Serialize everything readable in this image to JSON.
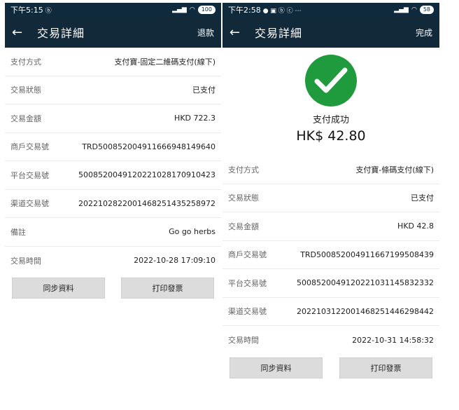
{
  "left": {
    "status_time": "下午5:15",
    "battery": "100",
    "title": "交易詳細",
    "action": "退款",
    "rows": [
      {
        "label": "支付方式",
        "value": "支付寶-固定二維碼支付(線下)"
      },
      {
        "label": "交易狀態",
        "value": "已支付"
      },
      {
        "label": "交易金額",
        "value": "HKD 722.3"
      },
      {
        "label": "商戶交易號",
        "value": "TRD5008520049116669481496​40"
      },
      {
        "label": "平台交易號",
        "value": "500852004912022102817091​0423"
      },
      {
        "label": "渠道交易號",
        "value": "2022102822001468251435258972"
      },
      {
        "label": "備註",
        "value": "Go go herbs"
      },
      {
        "label": "交易時間",
        "value": "2022-10-28 17:09:10"
      }
    ],
    "btn_sync": "同步資料",
    "btn_print": "打印發票"
  },
  "right": {
    "status_time": "下午2:58",
    "battery": "58",
    "title": "交易詳細",
    "action": "完成",
    "success_label": "支付成功",
    "amount": "HK$ 42.80",
    "rows": [
      {
        "label": "支付方式",
        "value": "支付寶-條碼支付(線下)"
      },
      {
        "label": "交易狀態",
        "value": "已支付"
      },
      {
        "label": "交易金額",
        "value": "HKD 42.8"
      },
      {
        "label": "商戶交易號",
        "value": "TRD500852004911667199508439"
      },
      {
        "label": "平台交易號",
        "value": "500852004912022103114583​2332"
      },
      {
        "label": "渠道交易號",
        "value": "2022103122001468251446298442"
      },
      {
        "label": "交易時間",
        "value": "2022-10-31 14:58:32"
      }
    ],
    "btn_sync": "同步資料",
    "btn_print": "打印發票"
  },
  "colors": {
    "header": "#12293a",
    "status_bar": "#0e2a3c",
    "success_green": "#1f9a3d",
    "button_gray": "#dcdcdc"
  },
  "icons": {
    "back": "arrow-left-icon",
    "success": "checkmark-circle-icon",
    "wifi": "wifi-icon",
    "signal": "signal-icon",
    "battery": "battery-icon"
  }
}
